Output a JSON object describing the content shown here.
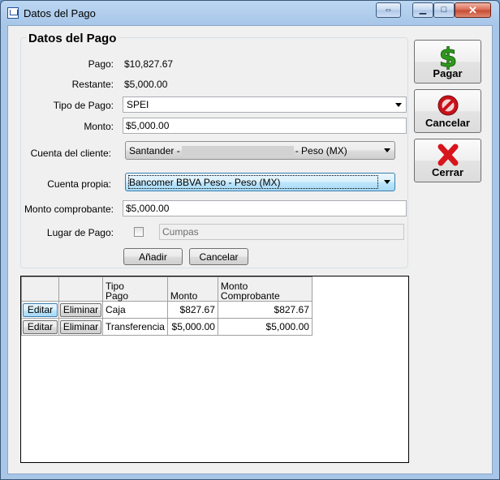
{
  "window": {
    "title": "Datos del Pago"
  },
  "form": {
    "group_title": "Datos del Pago",
    "pago_label": "Pago:",
    "pago_value": "$10,827.67",
    "restante_label": "Restante:",
    "restante_value": "$5,000.00",
    "tipo_label": "Tipo de Pago:",
    "tipo_value": "SPEI",
    "monto_label": "Monto:",
    "monto_value": "$5,000.00",
    "cuenta_cliente_label": "Cuenta del cliente:",
    "cuenta_cliente_prefix": "Santander -",
    "cuenta_cliente_suffix": "- Peso (MX)",
    "cuenta_propia_label": "Cuenta propia:",
    "cuenta_propia_value": "Bancomer BBVA Peso - Peso (MX)",
    "monto_comp_label": "Monto comprobante:",
    "monto_comp_value": "$5,000.00",
    "lugar_label": "Lugar de Pago:",
    "lugar_placeholder": "Cumpas",
    "add_label": "Añadir",
    "cancel_label": "Cancelar"
  },
  "side": {
    "pagar": "Pagar",
    "cancelar": "Cancelar",
    "cerrar": "Cerrar"
  },
  "table": {
    "headers": [
      "",
      "",
      "Tipo\nPago",
      "Monto",
      "Monto\nComprobante"
    ],
    "rows": [
      {
        "edit": "Editar",
        "delete": "Eliminar",
        "tipo": "Caja",
        "monto": "$827.67",
        "comprobante": "$827.67"
      },
      {
        "edit": "Editar",
        "delete": "Eliminar",
        "tipo": "Transferencia",
        "monto": "$5,000.00",
        "comprobante": "$5,000.00"
      }
    ]
  },
  "colors": {
    "accent": "#3c7fb1",
    "close": "#c44a32",
    "pagar_icon": "#2f9a1e",
    "cancel_icon": "#c8121b"
  }
}
